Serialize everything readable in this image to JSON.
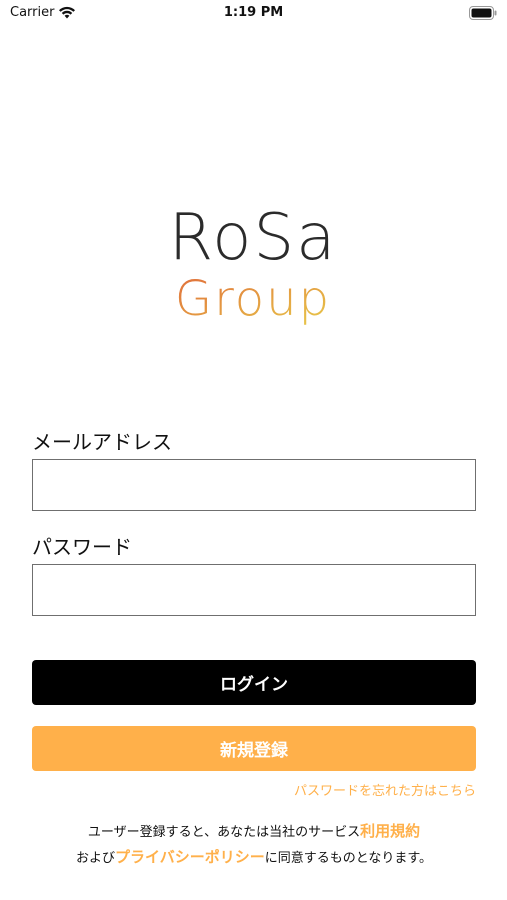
{
  "status_bar": {
    "carrier": "Carrier",
    "time": "1:19 PM",
    "wifi_icon": "wifi-icon",
    "battery_icon": "battery-icon"
  },
  "logo": {
    "line1": "RoSa",
    "line2": "Group",
    "colors": {
      "line1": "#2b2b2b",
      "gradient_start": "#e06a3a",
      "gradient_end": "#e8cc4a"
    }
  },
  "form": {
    "email_label": "メールアドレス",
    "email_value": "",
    "password_label": "パスワード",
    "password_value": "",
    "login_label": "ログイン",
    "register_label": "新規登録",
    "forgot_password": "パスワードを忘れた方はこちら"
  },
  "terms": {
    "text_before": "ユーザー登録すると、あなたは当社のサービス",
    "terms_link": "利用規約",
    "text_middle": "および",
    "privacy_link": "プライバシーポリシー",
    "text_after": "に同意するものとなります。"
  },
  "colors": {
    "accent": "#ffb04a",
    "login_bg": "#000000",
    "input_border": "#6f6f6f"
  }
}
